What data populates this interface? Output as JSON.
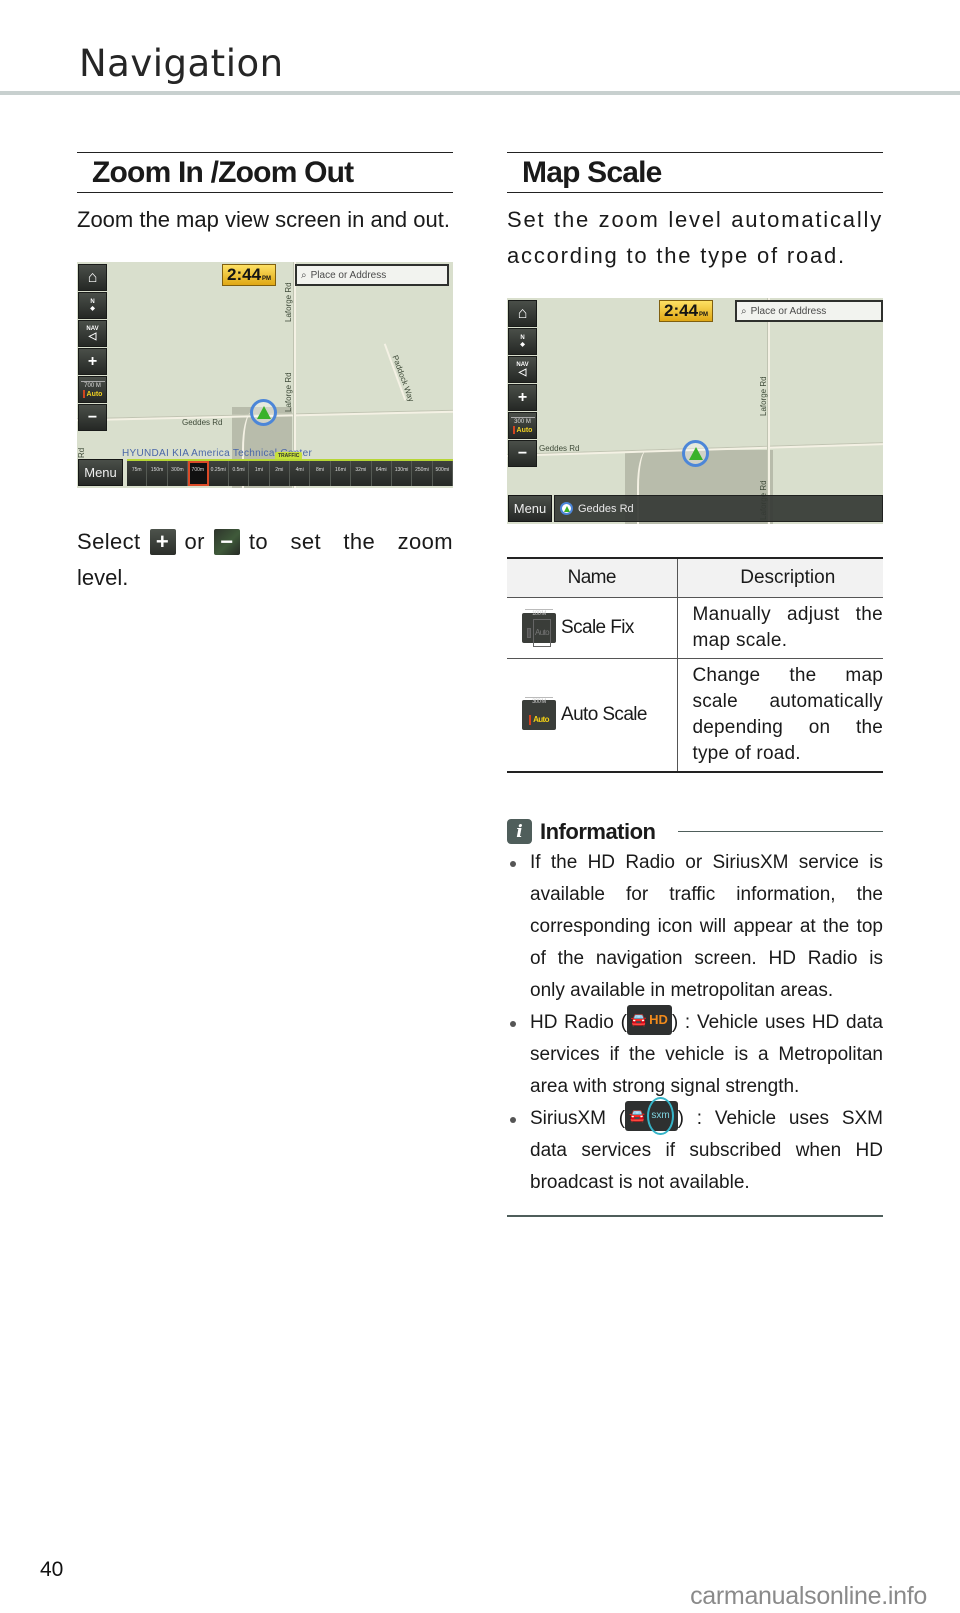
{
  "header": {
    "title": "Navigation"
  },
  "zoom_section": {
    "heading": "Zoom In /Zoom Out",
    "intro": "Zoom the map view screen in and out.",
    "screen": {
      "buttons": {
        "home_icon": "home-icon",
        "compass_label": "N",
        "nav_label": "NAV",
        "zoom_in": "+",
        "zoom_out": "−",
        "scale_value": "700 M",
        "scale_auto": "Auto",
        "menu": "Menu"
      },
      "clock": {
        "time": "2:44",
        "ampm": "PM"
      },
      "search_placeholder": "Place or Address",
      "road_labels": [
        "Geddes Rd",
        "Laforge Rd",
        "Laforge Rd",
        "Paddock Way",
        "Rd"
      ],
      "poi_label": "HYUNDAI KIA America Technical Center",
      "traffic_badge": "TRAFFIC",
      "scale_steps": [
        "75m",
        "150m",
        "300m",
        "700m",
        "0.25mi",
        "0.5mi",
        "1mi",
        "2mi",
        "4mi",
        "8mi",
        "16mi",
        "32mi",
        "64mi",
        "130mi",
        "250mi",
        "500mi"
      ],
      "selected_scale": "700m"
    },
    "instruction_before": "Select",
    "instruction_or": "or",
    "instruction_after": "to set the zoom",
    "instruction_end": "level."
  },
  "map_scale_section": {
    "heading": "Map Scale",
    "intro": "Set the zoom level automatically according to the type of road.",
    "screen": {
      "buttons": {
        "compass_label": "N",
        "nav_label": "NAV",
        "zoom_in": "+",
        "zoom_out": "−",
        "scale_value": "300 M",
        "scale_auto": "Auto",
        "menu": "Menu"
      },
      "clock": {
        "time": "2:44",
        "ampm": "PM"
      },
      "search_placeholder": "Place or Address",
      "road_labels": [
        "Geddes Rd",
        "Laforge Rd",
        "Laforge Rd"
      ],
      "current_road": "Geddes Rd"
    },
    "table": {
      "headers": [
        "Name",
        "Description"
      ],
      "rows": [
        {
          "name": "Scale Fix",
          "icon_scale": "100 M",
          "icon_auto": "Auto",
          "description": "Manually adjust the map scale."
        },
        {
          "name": "Auto Scale",
          "icon_scale": "300 M",
          "icon_auto": "Auto",
          "description": "Change the map scale automatically depending on the type of road."
        }
      ]
    }
  },
  "information": {
    "icon": "i",
    "title": "Information",
    "bullets": [
      {
        "text": "If the HD Radio or SiriusXM service is available for traffic information, the corresponding icon will appear at the top of the navigation screen. HD Radio is only available in metropolitan areas."
      },
      {
        "prefix": "HD Radio (",
        "icon_label": "HD",
        "suffix": ") : Vehicle uses HD data services if the vehicle is a Metropolitan area with strong signal strength."
      },
      {
        "prefix": "SiriusXM (",
        "icon_label": "sxm",
        "suffix": ") : Vehicle uses SXM data services if subscribed when HD broadcast is not available."
      }
    ]
  },
  "footer": {
    "page_number": "40",
    "watermark": "carmanualsonline.info"
  }
}
